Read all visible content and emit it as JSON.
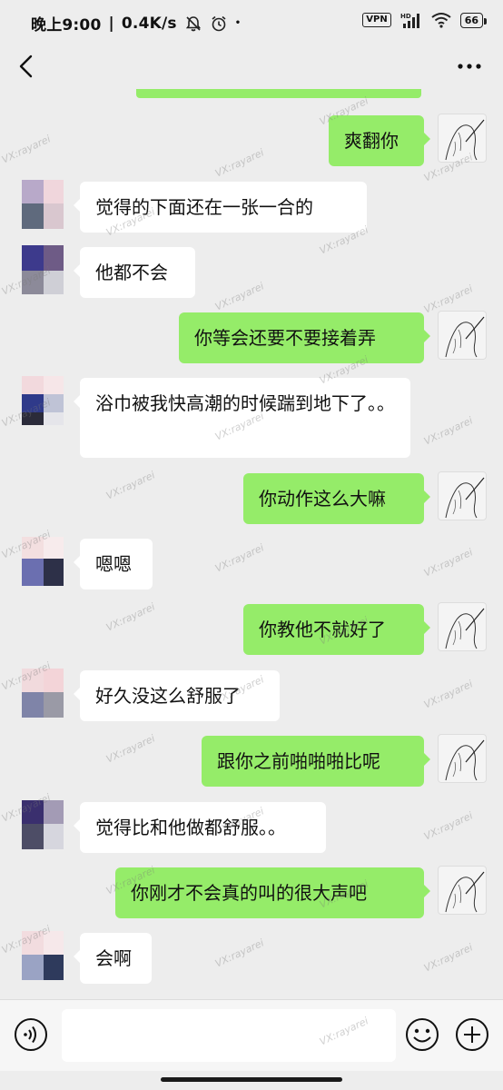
{
  "status_bar": {
    "time": "晚上9:00",
    "speed": "0.4K/s",
    "vpn": "VPN",
    "battery": "66"
  },
  "watermark_text": "VX:rayarei",
  "messages": [
    {
      "side": "right",
      "text": "爽翻你"
    },
    {
      "side": "left",
      "text": "觉得的下面还在一张一合的"
    },
    {
      "side": "left",
      "text": "他都不会"
    },
    {
      "side": "right",
      "text": "你等会还要不要接着弄"
    },
    {
      "side": "left",
      "text": "浴巾被我快高潮的时候踹到地下了。。"
    },
    {
      "side": "right",
      "text": "你动作这么大嘛"
    },
    {
      "side": "left",
      "text": "嗯嗯"
    },
    {
      "side": "right",
      "text": "你教他不就好了"
    },
    {
      "side": "left",
      "text": "好久没这么舒服了"
    },
    {
      "side": "right",
      "text": "跟你之前啪啪啪比呢"
    },
    {
      "side": "left",
      "text": "觉得比和他做都舒服。。"
    },
    {
      "side": "right",
      "text": "你刚才不会真的叫的很大声吧"
    },
    {
      "side": "left",
      "text": "会啊"
    }
  ],
  "input": {
    "placeholder": ""
  },
  "icons": {
    "back": "back-arrow-icon",
    "more": "more-dots-icon",
    "voice": "voice-icon",
    "emoji": "emoji-icon",
    "plus": "plus-icon",
    "silent": "bell-off-icon",
    "alarm": "alarm-icon",
    "wifi": "wifi-icon",
    "signal": "signal-icon"
  },
  "colors": {
    "chat_bg": "#ededed",
    "sent_bubble": "#95ec69",
    "received_bubble": "#ffffff"
  }
}
